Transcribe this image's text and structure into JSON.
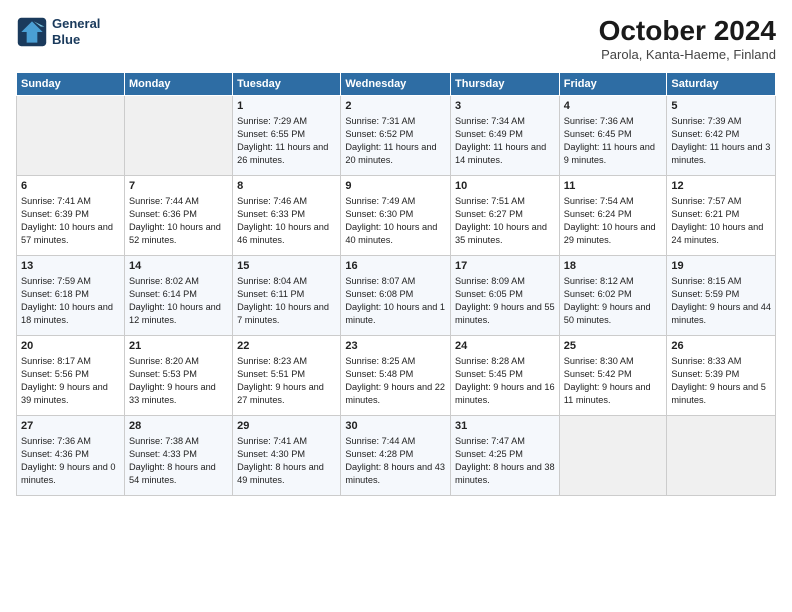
{
  "logo": {
    "line1": "General",
    "line2": "Blue"
  },
  "title": "October 2024",
  "subtitle": "Parola, Kanta-Haeme, Finland",
  "headers": [
    "Sunday",
    "Monday",
    "Tuesday",
    "Wednesday",
    "Thursday",
    "Friday",
    "Saturday"
  ],
  "weeks": [
    [
      {
        "day": "",
        "sunrise": "",
        "sunset": "",
        "daylight": ""
      },
      {
        "day": "",
        "sunrise": "",
        "sunset": "",
        "daylight": ""
      },
      {
        "day": "1",
        "sunrise": "Sunrise: 7:29 AM",
        "sunset": "Sunset: 6:55 PM",
        "daylight": "Daylight: 11 hours and 26 minutes."
      },
      {
        "day": "2",
        "sunrise": "Sunrise: 7:31 AM",
        "sunset": "Sunset: 6:52 PM",
        "daylight": "Daylight: 11 hours and 20 minutes."
      },
      {
        "day": "3",
        "sunrise": "Sunrise: 7:34 AM",
        "sunset": "Sunset: 6:49 PM",
        "daylight": "Daylight: 11 hours and 14 minutes."
      },
      {
        "day": "4",
        "sunrise": "Sunrise: 7:36 AM",
        "sunset": "Sunset: 6:45 PM",
        "daylight": "Daylight: 11 hours and 9 minutes."
      },
      {
        "day": "5",
        "sunrise": "Sunrise: 7:39 AM",
        "sunset": "Sunset: 6:42 PM",
        "daylight": "Daylight: 11 hours and 3 minutes."
      }
    ],
    [
      {
        "day": "6",
        "sunrise": "Sunrise: 7:41 AM",
        "sunset": "Sunset: 6:39 PM",
        "daylight": "Daylight: 10 hours and 57 minutes."
      },
      {
        "day": "7",
        "sunrise": "Sunrise: 7:44 AM",
        "sunset": "Sunset: 6:36 PM",
        "daylight": "Daylight: 10 hours and 52 minutes."
      },
      {
        "day": "8",
        "sunrise": "Sunrise: 7:46 AM",
        "sunset": "Sunset: 6:33 PM",
        "daylight": "Daylight: 10 hours and 46 minutes."
      },
      {
        "day": "9",
        "sunrise": "Sunrise: 7:49 AM",
        "sunset": "Sunset: 6:30 PM",
        "daylight": "Daylight: 10 hours and 40 minutes."
      },
      {
        "day": "10",
        "sunrise": "Sunrise: 7:51 AM",
        "sunset": "Sunset: 6:27 PM",
        "daylight": "Daylight: 10 hours and 35 minutes."
      },
      {
        "day": "11",
        "sunrise": "Sunrise: 7:54 AM",
        "sunset": "Sunset: 6:24 PM",
        "daylight": "Daylight: 10 hours and 29 minutes."
      },
      {
        "day": "12",
        "sunrise": "Sunrise: 7:57 AM",
        "sunset": "Sunset: 6:21 PM",
        "daylight": "Daylight: 10 hours and 24 minutes."
      }
    ],
    [
      {
        "day": "13",
        "sunrise": "Sunrise: 7:59 AM",
        "sunset": "Sunset: 6:18 PM",
        "daylight": "Daylight: 10 hours and 18 minutes."
      },
      {
        "day": "14",
        "sunrise": "Sunrise: 8:02 AM",
        "sunset": "Sunset: 6:14 PM",
        "daylight": "Daylight: 10 hours and 12 minutes."
      },
      {
        "day": "15",
        "sunrise": "Sunrise: 8:04 AM",
        "sunset": "Sunset: 6:11 PM",
        "daylight": "Daylight: 10 hours and 7 minutes."
      },
      {
        "day": "16",
        "sunrise": "Sunrise: 8:07 AM",
        "sunset": "Sunset: 6:08 PM",
        "daylight": "Daylight: 10 hours and 1 minute."
      },
      {
        "day": "17",
        "sunrise": "Sunrise: 8:09 AM",
        "sunset": "Sunset: 6:05 PM",
        "daylight": "Daylight: 9 hours and 55 minutes."
      },
      {
        "day": "18",
        "sunrise": "Sunrise: 8:12 AM",
        "sunset": "Sunset: 6:02 PM",
        "daylight": "Daylight: 9 hours and 50 minutes."
      },
      {
        "day": "19",
        "sunrise": "Sunrise: 8:15 AM",
        "sunset": "Sunset: 5:59 PM",
        "daylight": "Daylight: 9 hours and 44 minutes."
      }
    ],
    [
      {
        "day": "20",
        "sunrise": "Sunrise: 8:17 AM",
        "sunset": "Sunset: 5:56 PM",
        "daylight": "Daylight: 9 hours and 39 minutes."
      },
      {
        "day": "21",
        "sunrise": "Sunrise: 8:20 AM",
        "sunset": "Sunset: 5:53 PM",
        "daylight": "Daylight: 9 hours and 33 minutes."
      },
      {
        "day": "22",
        "sunrise": "Sunrise: 8:23 AM",
        "sunset": "Sunset: 5:51 PM",
        "daylight": "Daylight: 9 hours and 27 minutes."
      },
      {
        "day": "23",
        "sunrise": "Sunrise: 8:25 AM",
        "sunset": "Sunset: 5:48 PM",
        "daylight": "Daylight: 9 hours and 22 minutes."
      },
      {
        "day": "24",
        "sunrise": "Sunrise: 8:28 AM",
        "sunset": "Sunset: 5:45 PM",
        "daylight": "Daylight: 9 hours and 16 minutes."
      },
      {
        "day": "25",
        "sunrise": "Sunrise: 8:30 AM",
        "sunset": "Sunset: 5:42 PM",
        "daylight": "Daylight: 9 hours and 11 minutes."
      },
      {
        "day": "26",
        "sunrise": "Sunrise: 8:33 AM",
        "sunset": "Sunset: 5:39 PM",
        "daylight": "Daylight: 9 hours and 5 minutes."
      }
    ],
    [
      {
        "day": "27",
        "sunrise": "Sunrise: 7:36 AM",
        "sunset": "Sunset: 4:36 PM",
        "daylight": "Daylight: 9 hours and 0 minutes."
      },
      {
        "day": "28",
        "sunrise": "Sunrise: 7:38 AM",
        "sunset": "Sunset: 4:33 PM",
        "daylight": "Daylight: 8 hours and 54 minutes."
      },
      {
        "day": "29",
        "sunrise": "Sunrise: 7:41 AM",
        "sunset": "Sunset: 4:30 PM",
        "daylight": "Daylight: 8 hours and 49 minutes."
      },
      {
        "day": "30",
        "sunrise": "Sunrise: 7:44 AM",
        "sunset": "Sunset: 4:28 PM",
        "daylight": "Daylight: 8 hours and 43 minutes."
      },
      {
        "day": "31",
        "sunrise": "Sunrise: 7:47 AM",
        "sunset": "Sunset: 4:25 PM",
        "daylight": "Daylight: 8 hours and 38 minutes."
      },
      {
        "day": "",
        "sunrise": "",
        "sunset": "",
        "daylight": ""
      },
      {
        "day": "",
        "sunrise": "",
        "sunset": "",
        "daylight": ""
      }
    ]
  ]
}
